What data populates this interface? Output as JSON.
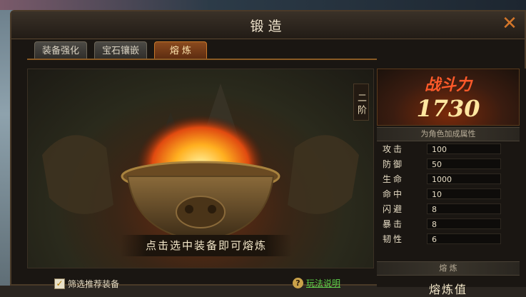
{
  "window": {
    "title": "锻造",
    "close_icon": "close-icon"
  },
  "tabs": [
    {
      "label": "装备强化",
      "active": false
    },
    {
      "label": "宝石镶嵌",
      "active": false
    },
    {
      "label": "熔 炼",
      "active": true
    }
  ],
  "stage": {
    "rank": "二 阶",
    "hint": "点击选中装备即可熔炼"
  },
  "filter": {
    "label": "筛选推荐装备",
    "checked": true
  },
  "help": {
    "icon": "question-icon",
    "label": "玩法说明"
  },
  "power": {
    "label": "战斗力",
    "value": "1730"
  },
  "attributes_header": "为角色加成属性",
  "attributes": [
    {
      "name": "攻击",
      "value": "100"
    },
    {
      "name": "防御",
      "value": "50"
    },
    {
      "name": "生命",
      "value": "1000"
    },
    {
      "name": "命中",
      "value": "10"
    },
    {
      "name": "闪避",
      "value": "8"
    },
    {
      "name": "暴击",
      "value": "8"
    },
    {
      "name": "韧性",
      "value": "6"
    }
  ],
  "smelt_header": "熔 炼",
  "smelt_value_label": "熔炼值",
  "colors": {
    "accent": "#c8782a",
    "link": "#5fd24a",
    "power": "#ff5a2a"
  }
}
